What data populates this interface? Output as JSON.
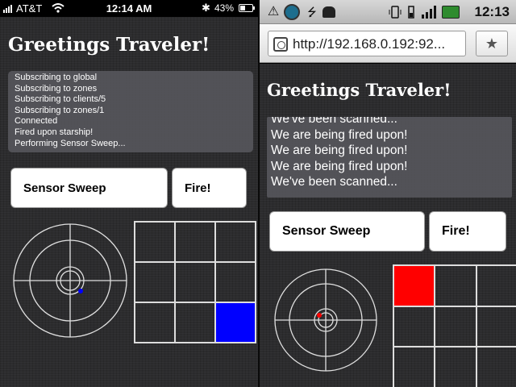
{
  "colors": {
    "blue_player": "#0000ff",
    "red_player": "#ff0000",
    "panel": "rgba(90,90,96,0.82)",
    "grid_lines": "#dddddd"
  },
  "iphone": {
    "status": {
      "carrier": "AT&T",
      "time": "12:14 AM",
      "battery_text": "43%",
      "battery_level": 0.43,
      "icons": [
        "signal-icon",
        "wifi-icon",
        "bluetooth-icon",
        "battery-icon"
      ]
    },
    "title": "Greetings Traveler!",
    "log": [
      "Subscribing to global",
      "Subscribing to zones",
      "Subscribing to clients/5",
      "Subscribing to zones/1",
      "Connected",
      "Fired upon starship!",
      "Performing Sensor Sweep..."
    ],
    "buttons": {
      "sweep": "Sensor Sweep",
      "fire": "Fire!"
    },
    "grid_highlight": {
      "row": 2,
      "col": 2,
      "color": "#0000ff"
    },
    "radar_blip": {
      "color": "#0000ff"
    }
  },
  "android": {
    "status": {
      "time": "12:13",
      "icons": [
        "warning-icon",
        "app-icon",
        "usb-icon",
        "android-icon",
        "vibrate-icon",
        "wifi-icon",
        "signal-icon",
        "battery-icon"
      ]
    },
    "url": "http://192.168.0.192:92...",
    "title": "Greetings Traveler!",
    "log": [
      "We've been scanned...",
      "We are being fired upon!",
      "We are being fired upon!",
      "We are being fired upon!",
      "We've been scanned..."
    ],
    "buttons": {
      "sweep": "Sensor Sweep",
      "fire": "Fire!"
    },
    "grid_highlight": {
      "row": 0,
      "col": 0,
      "color": "#ff0000"
    },
    "radar_blip": {
      "color": "#ff0000"
    }
  }
}
